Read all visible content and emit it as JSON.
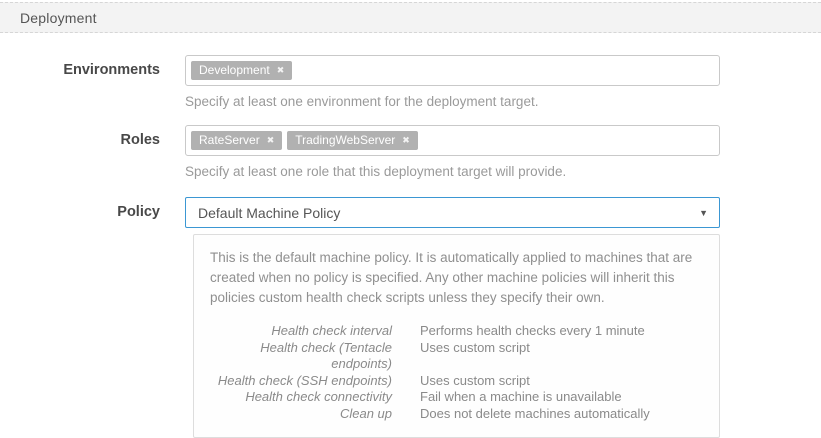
{
  "section": {
    "title": "Deployment"
  },
  "icons": {
    "remove_tag": "✖",
    "dropdown_arrow": "▼"
  },
  "colors": {
    "accent_blue": "#3b97d3",
    "tag_gray": "#b1b1b1",
    "header_bg": "#f3f3f3",
    "border_gray": "#c9c9c9",
    "help_text": "#9a9a9a"
  },
  "fields": {
    "environments": {
      "label": "Environments",
      "tags": [
        {
          "text": "Development"
        }
      ],
      "help": "Specify at least one environment for the deployment target."
    },
    "roles": {
      "label": "Roles",
      "tags": [
        {
          "text": "RateServer"
        },
        {
          "text": "TradingWebServer"
        }
      ],
      "help": "Specify at least one role that this deployment target will provide."
    },
    "policy": {
      "label": "Policy",
      "selected": "Default Machine Policy",
      "description": "This is the default machine policy. It is automatically applied to machines that are created when no policy is specified. Any other machine policies will inherit this policies custom health check scripts unless they specify their own.",
      "details": [
        {
          "name": "Health check interval",
          "value": "Performs health checks every 1 minute"
        },
        {
          "name": "Health check (Tentacle endpoints)",
          "value": "Uses custom script"
        },
        {
          "name": "Health check (SSH endpoints)",
          "value": "Uses custom script"
        },
        {
          "name": "Health check connectivity",
          "value": "Fail when a machine is unavailable"
        },
        {
          "name": "Clean up",
          "value": "Does not delete machines automatically"
        }
      ]
    }
  }
}
